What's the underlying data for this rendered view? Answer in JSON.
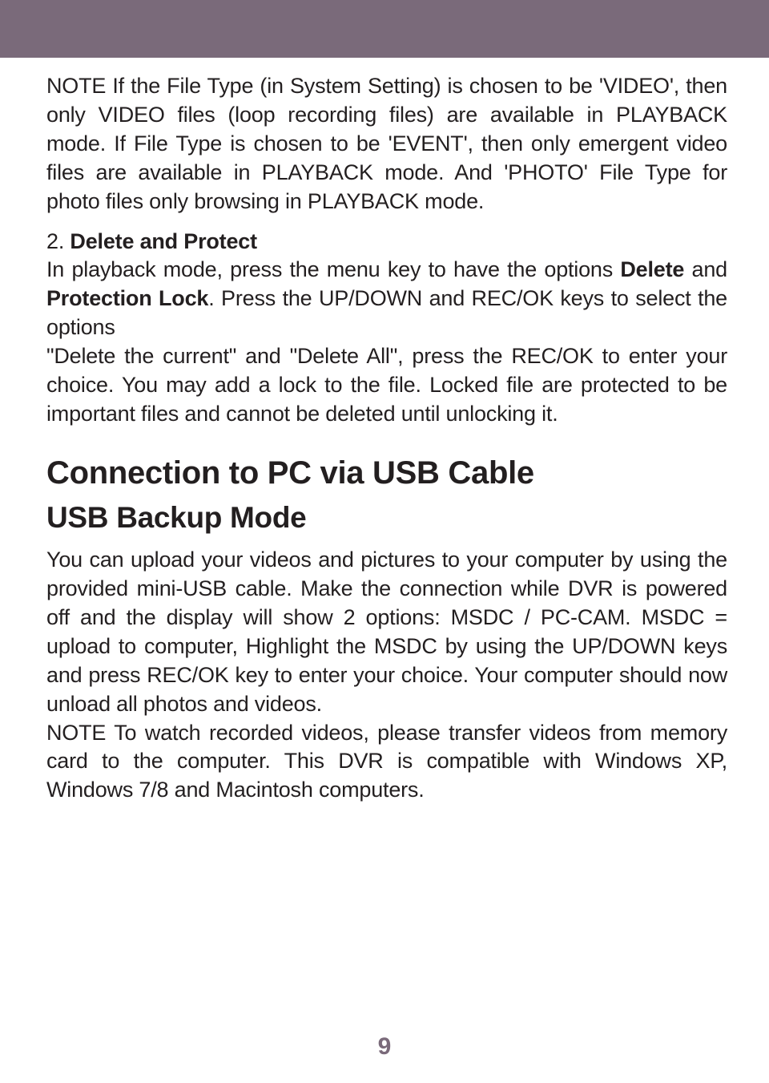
{
  "note_paragraph": {
    "text": "NOTE If the File Type (in System Setting) is chosen to be 'VIDEO', then only VIDEO files (loop recording files) are available in PLAYBACK mode. If File Type is chosen to be 'EVENT', then only emergent video files are available in PLAYBACK mode. And 'PHOTO' File Type for photo files only browsing in PLAYBACK mode."
  },
  "delete_protect": {
    "lead_num": "2. ",
    "lead_bold": "Delete and Protect",
    "line1_a": "In playback mode, press the menu key to have the options ",
    "line1_bold1": "Delete",
    "line1_b": " and ",
    "line1_bold2": "Protection Lock",
    "line1_c": ". Press the UP/DOWN and REC/OK keys to select the options",
    "line2": "\"Delete the current\" and \"Delete All\", press the REC/OK to enter your choice. You may add a lock to the file. Locked file are protected to be important files and cannot be deleted until unlocking it."
  },
  "headings": {
    "h1": "Connection to PC via USB Cable",
    "h2": "USB Backup Mode"
  },
  "usb_body": {
    "p1": "You can upload your videos and pictures to your computer by using the provided mini-USB cable. Make the connection while DVR is powered off and the display will show 2 options: MSDC / PC-CAM. MSDC = upload to computer, Highlight the MSDC by using the UP/DOWN keys and press REC/OK key to enter your choice. Your computer should now unload all photos and videos.",
    "p2": "NOTE To watch recorded videos, please transfer videos from memory card to the computer. This DVR is compatible with Windows XP, Windows 7/8 and Macintosh computers."
  },
  "page_number": "9"
}
